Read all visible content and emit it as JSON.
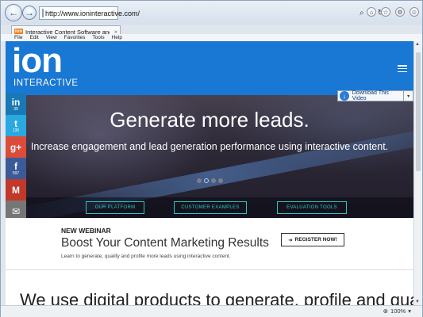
{
  "browser": {
    "url": "http://www.ioninteractive.com/",
    "tab": {
      "favicon_text": "ion",
      "title": "Interactive Content Software and ...",
      "close": "×"
    },
    "menu": [
      "File",
      "Edit",
      "View",
      "Favorites",
      "Tools",
      "Help"
    ],
    "zoom": "100%"
  },
  "site": {
    "logo_word": "ion",
    "logo_sub": "INTERACTIVE",
    "download_button": "Download This Video",
    "hero": {
      "title": "Generate more leads.",
      "subtitle": "Increase engagement and lead generation performance using interactive content.",
      "active_slide": 2,
      "slide_count": 4,
      "buttons": [
        "OUR PLATFORM",
        "CUSTOMER EXAMPLES",
        "EVALUATION TOOLS"
      ]
    },
    "share": [
      {
        "name": "linkedin",
        "glyph": "in",
        "count": "39",
        "color": "#1a78b4"
      },
      {
        "name": "twitter",
        "glyph": "t",
        "count": "135",
        "color": "#29a9e0"
      },
      {
        "name": "googleplus",
        "glyph": "g+",
        "count": "",
        "color": "#dd4b39"
      },
      {
        "name": "facebook",
        "glyph": "f",
        "count": "597",
        "color": "#3b5b98"
      },
      {
        "name": "gmail",
        "glyph": "M",
        "count": "",
        "color": "#c0392b"
      },
      {
        "name": "email",
        "glyph": "✉",
        "count": "",
        "color": "#767676"
      }
    ],
    "webinar": {
      "label": "NEW WEBINAR",
      "title": "Boost Your Content Marketing Results",
      "description": "Learn to generate, qualify and profile more leads using interactive content.",
      "register": "REGISTER NOW!"
    },
    "clipped_text": "We use digital products to generate, profile and qualify"
  }
}
